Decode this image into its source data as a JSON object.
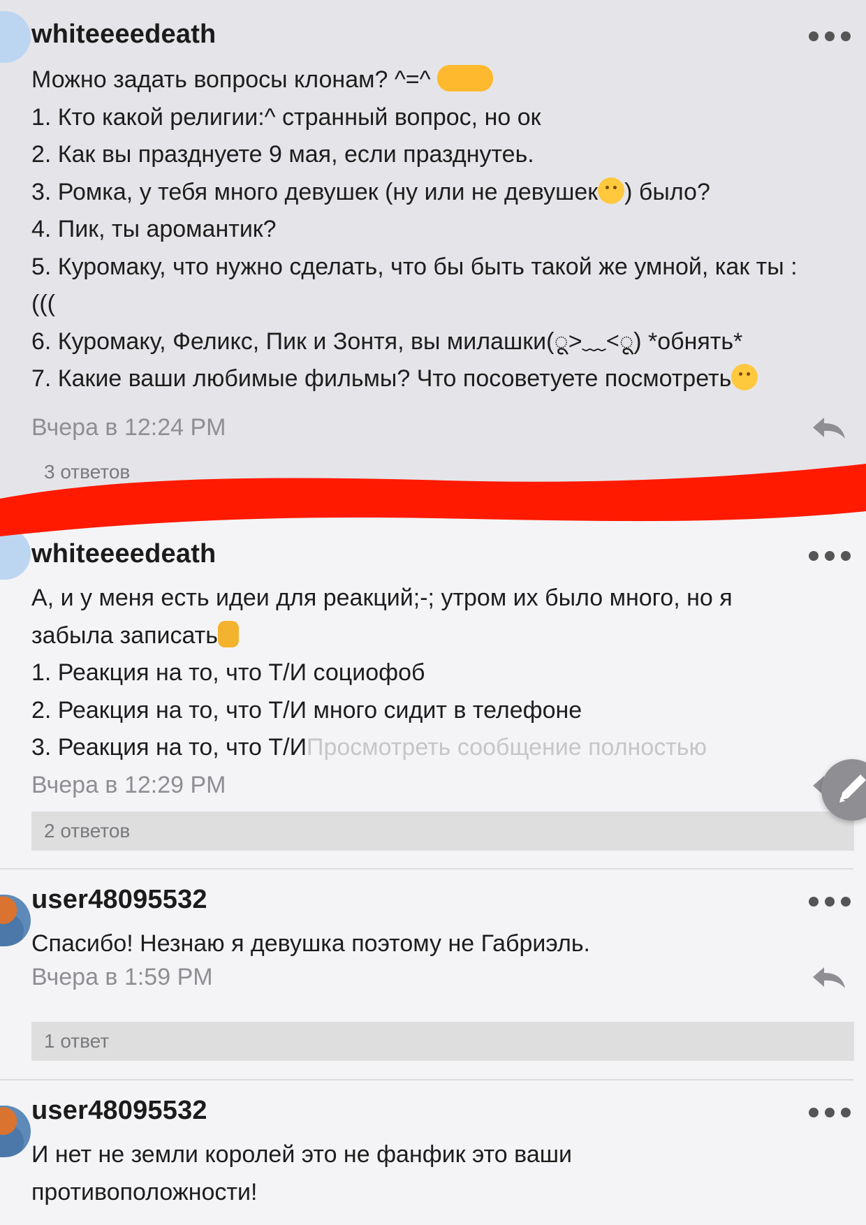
{
  "comments": [
    {
      "username": "whiteeeedeath",
      "lines": [
        "Можно задать вопросы клонам? ^=^",
        "1. Кто какой религии:^ странный вопрос, но ок",
        "2. Как вы празднуете 9 мая, если празднутеь.",
        "3. Ромка, у тебя много девушек (ну или не девушек",
        ") было?",
        "4. Пик, ты аромантик?",
        "5. Куромаку, что нужно сделать, что бы быть такой же умной, как ты :",
        "(((",
        "6. Куромаку, Феликс, Пик и Зонтя, вы милашки(",
        ") *обнять*",
        "7. Какие ваши любимые фильмы? Что посоветуете посмотреть"
      ],
      "kaomoji": "ू>﹏<ू",
      "time": "Вчера в 12:24 PM",
      "replies": "3 ответов",
      "icons": [
        "pointing-hands-emoji",
        "smile-emoji",
        "sneeze-emoji"
      ]
    },
    {
      "username": "whiteeeedeath",
      "lines": [
        "А, и у меня есть идеи для реакций;-; утром их было много, но я",
        "забыла записать",
        "1. Реакция на то, что Т/И социофоб",
        "2. Реакция на то, что Т/И много сидит в телефоне",
        "3. Реакция на то, что Т/И"
      ],
      "view_full": "Просмотреть сообщение полностью",
      "time": "Вчера в 12:29 PM",
      "replies": "2 ответов",
      "icons": [
        "thumbs-up-emoji"
      ]
    },
    {
      "username": "user48095532",
      "lines": [
        "Спасибо! Незнаю я девушка поэтому не Габриэль."
      ],
      "time": "Вчера в 1:59 PM",
      "replies": "1 ответ"
    },
    {
      "username": "user48095532",
      "lines": [
        "И нет не земли королей это не фанфик это ваши",
        "противоположности!"
      ]
    }
  ],
  "colors": {
    "highlight_bg": "#e5e5e9",
    "page_bg": "#f4f4f6",
    "red_marker": "#ff1a00",
    "time_text": "#8e8e93"
  },
  "annotation": "red-marker-stroke"
}
